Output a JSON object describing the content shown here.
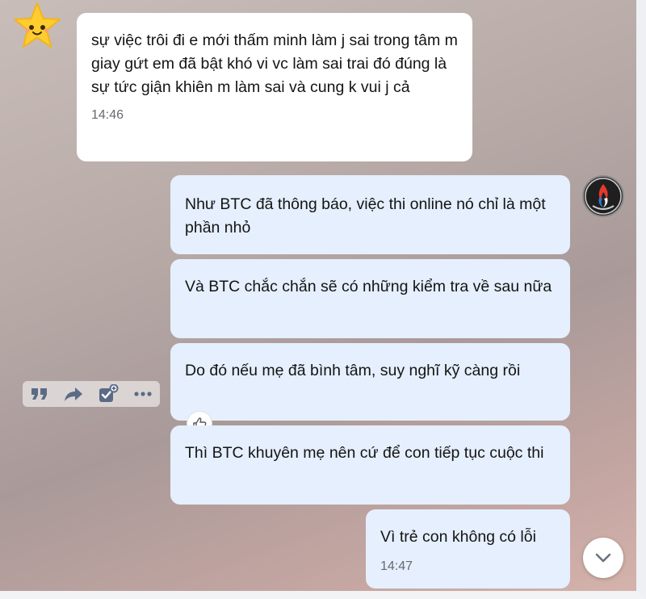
{
  "avatars": {
    "sender": "star-emoji-avatar",
    "me": "club-logo-avatar"
  },
  "messages": [
    {
      "text": "sự việc trôi đi e mới thấm minh làm j sai trong tâm m giay gứt em đã bật khó vi vc làm sai trai đó đúng là sự tức giận khiên m làm sai và cung k vui j cả",
      "time": "14:46"
    },
    {
      "text": "Như BTC đã thông báo, việc thi online nó chỉ là một phần nhỏ"
    },
    {
      "text": "Và BTC chắc chắn sẽ có những kiểm tra về sau nữa"
    },
    {
      "text": "Do đó nếu mẹ đã bình tâm, suy nghĩ kỹ càng rồi"
    },
    {
      "text": "Thì BTC khuyên mẹ nên cứ để con tiếp tục cuộc thi"
    },
    {
      "text": "Vì trẻ con không có lỗi",
      "time": "14:47"
    }
  ],
  "hover_actions": [
    "quote-icon",
    "forward-icon",
    "task-icon",
    "more-icon"
  ],
  "reaction": "thumbs-up-icon",
  "colors": {
    "incoming_bubble": "#ffffff",
    "outgoing_bubble": "#e5effd"
  }
}
